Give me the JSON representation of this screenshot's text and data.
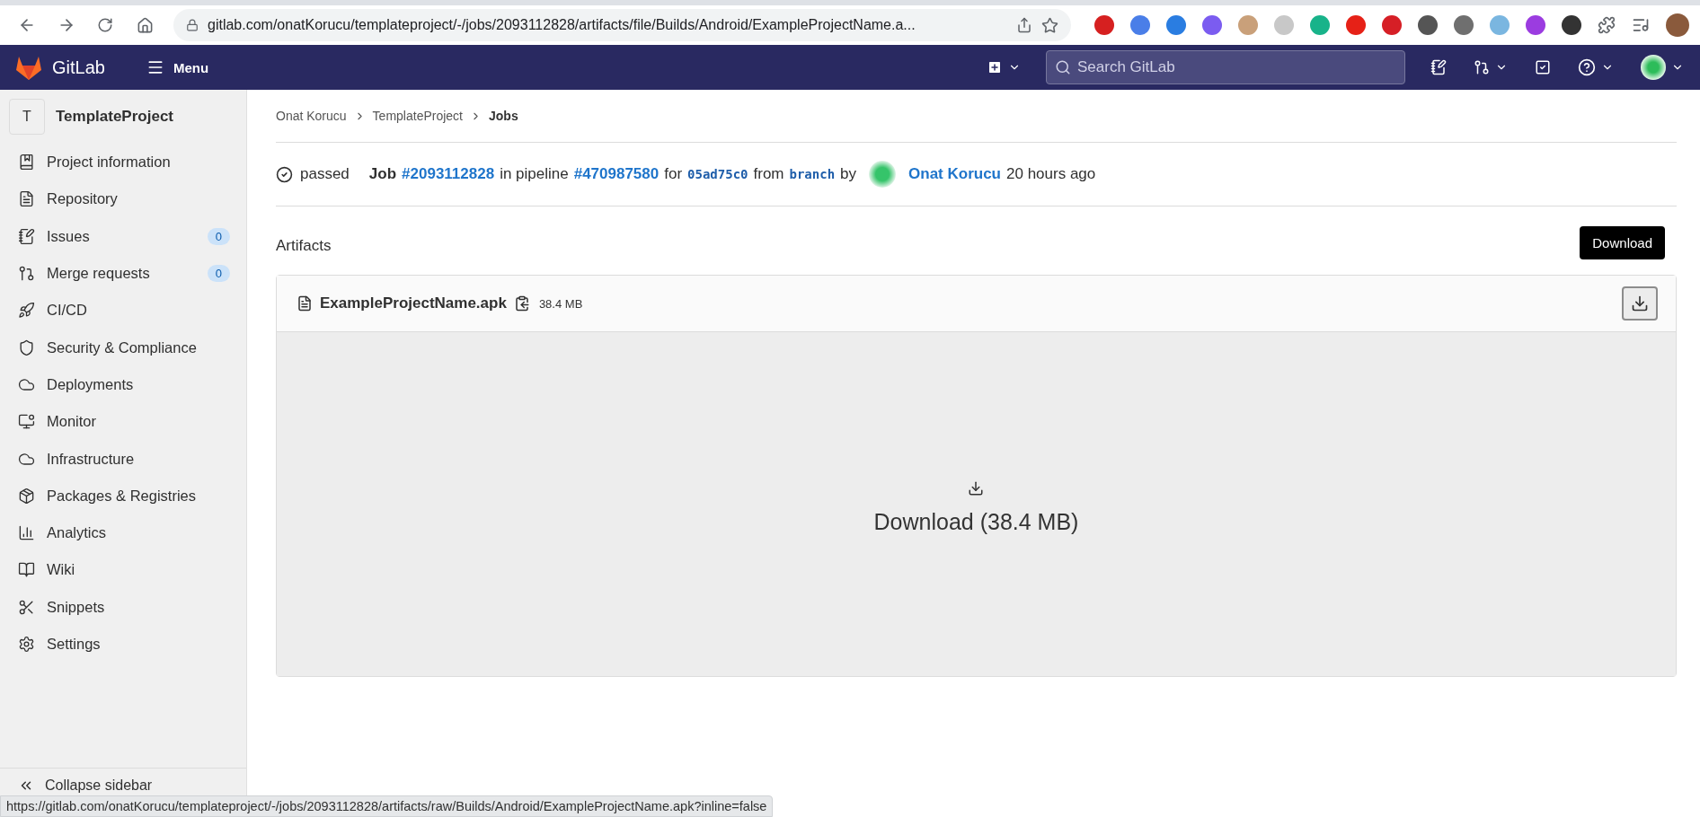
{
  "browser": {
    "url": "gitlab.com/onatKorucu/templateproject/-/jobs/2093112828/artifacts/file/Builds/Android/ExampleProjectName.a...",
    "status_url": "https://gitlab.com/onatKorucu/templateproject/-/jobs/2093112828/artifacts/raw/Builds/Android/ExampleProjectName.apk?inline=false"
  },
  "navbar": {
    "brand": "GitLab",
    "menu": "Menu",
    "search": {
      "placeholder": "Search GitLab"
    }
  },
  "sidebar": {
    "project_initial": "T",
    "project_name": "TemplateProject",
    "items": [
      {
        "label": "Project information"
      },
      {
        "label": "Repository"
      },
      {
        "label": "Issues",
        "badge": "0"
      },
      {
        "label": "Merge requests",
        "badge": "0"
      },
      {
        "label": "CI/CD"
      },
      {
        "label": "Security & Compliance"
      },
      {
        "label": "Deployments"
      },
      {
        "label": "Monitor"
      },
      {
        "label": "Infrastructure"
      },
      {
        "label": "Packages & Registries"
      },
      {
        "label": "Analytics"
      },
      {
        "label": "Wiki"
      },
      {
        "label": "Snippets"
      },
      {
        "label": "Settings"
      }
    ],
    "collapse": "Collapse sidebar"
  },
  "breadcrumbs": [
    {
      "label": "Onat Korucu",
      "selected": false
    },
    {
      "label": "TemplateProject",
      "selected": false
    },
    {
      "label": "Jobs",
      "selected": true
    }
  ],
  "job": {
    "status": "passed",
    "job_label": "Job",
    "job_id": "#2093112828",
    "in_pipeline": "in pipeline",
    "pipeline_id": "#470987580",
    "for": "for",
    "commit": "05ad75c0",
    "from": "from",
    "ref": "branch",
    "by": "by",
    "author": "Onat Korucu",
    "time": "20 hours ago"
  },
  "artifacts": {
    "heading": "Artifacts",
    "file_name": "ExampleProjectName.apk",
    "file_size": "38.4 MB",
    "tooltip": "Download",
    "download": "Download (38.4 MB)"
  }
}
